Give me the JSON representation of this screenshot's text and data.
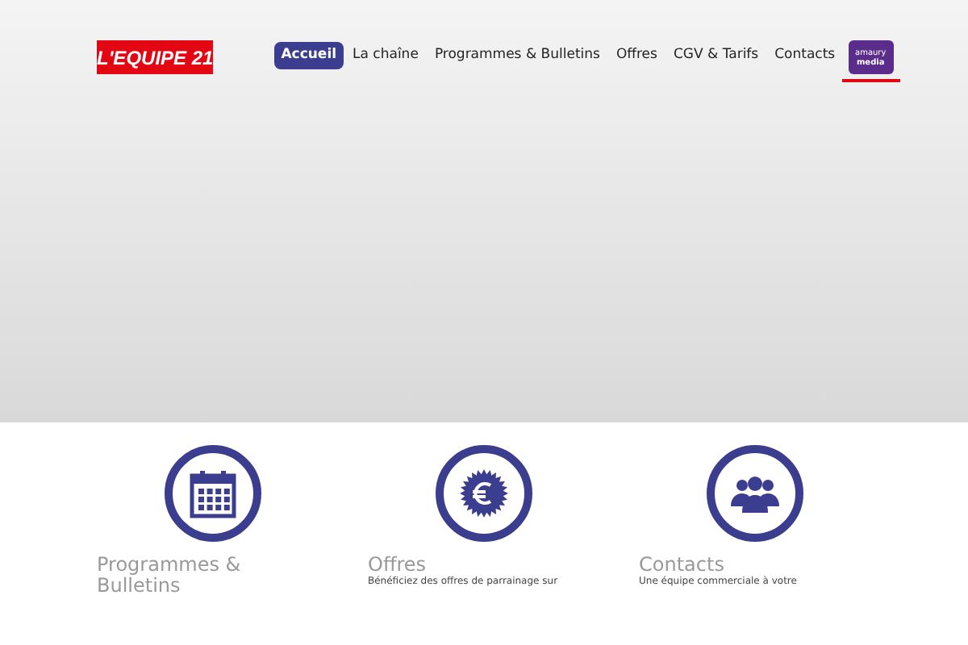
{
  "header": {
    "logo": "L'EQUIPE 21",
    "nav": [
      {
        "label": "Accueil",
        "selected": true
      },
      {
        "label": "La chaîne",
        "selected": false
      },
      {
        "label": "Programmes & Bulletins",
        "selected": false
      },
      {
        "label": "Offres",
        "selected": false
      },
      {
        "label": "CGV & Tarifs",
        "selected": false
      },
      {
        "label": "Contacts",
        "selected": false
      }
    ],
    "partner_logo": {
      "line_1": "amaury",
      "line_2": "media"
    }
  },
  "features": [
    {
      "kind": "calendar",
      "title": "Programmes & Bulletins"
    },
    {
      "kind": "euro",
      "title": "Offres",
      "text": "Bénéficiez des offres de parrainage sur"
    },
    {
      "kind": "people",
      "title": "Contacts",
      "text": "Une équipe commerciale à votre"
    }
  ]
}
